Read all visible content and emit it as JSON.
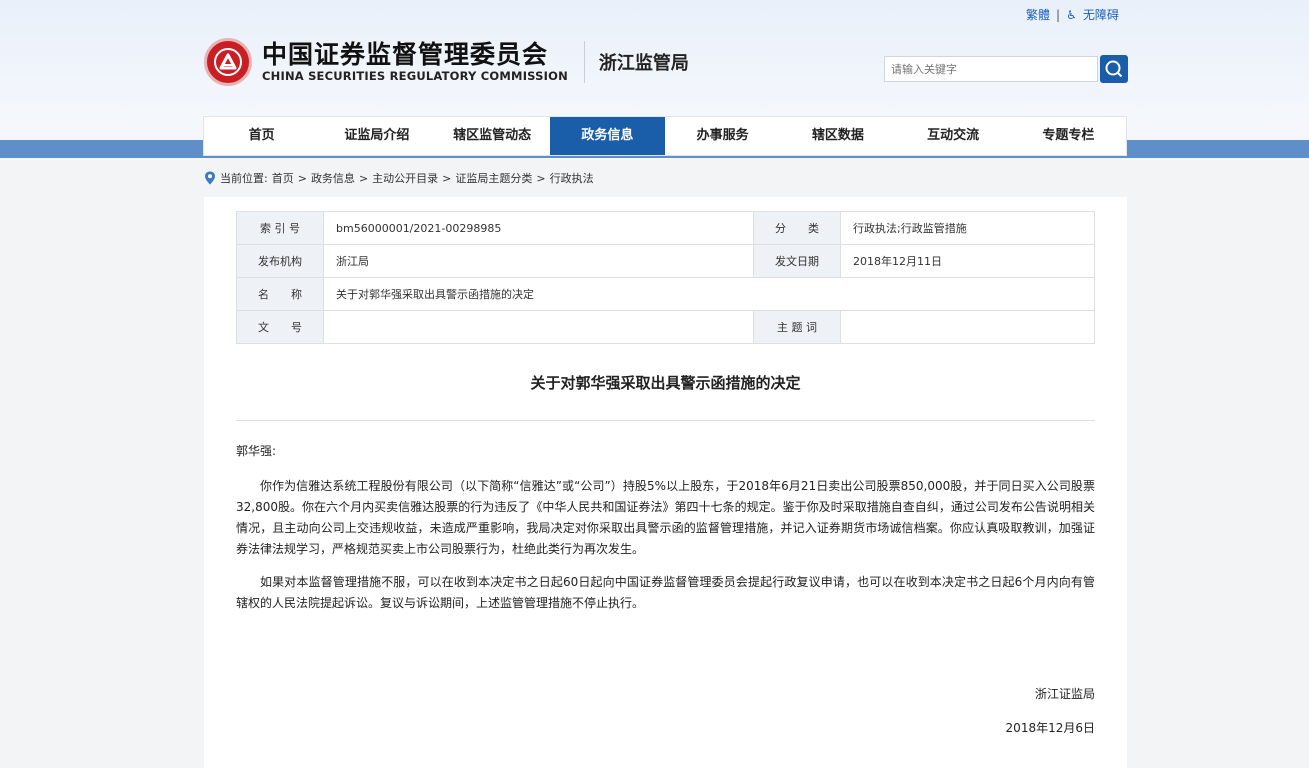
{
  "header": {
    "lang_toggle": "繁體",
    "accessibility": "无障碍",
    "logo_cn": "中国证券监督管理委员会",
    "logo_en": "CHINA SECURITIES REGULATORY COMMISSION",
    "bureau": "浙江监管局",
    "search_placeholder": "请输入关键字"
  },
  "nav": {
    "items": [
      "首页",
      "证监局介绍",
      "辖区监管动态",
      "政务信息",
      "办事服务",
      "辖区数据",
      "互动交流",
      "专题专栏"
    ],
    "active_index": 3
  },
  "breadcrumb": {
    "prefix": "当前位置:",
    "items": [
      "首页",
      "政务信息",
      "主动公开目录",
      "证监局主题分类",
      "行政执法"
    ],
    "separator": ">"
  },
  "meta": {
    "index_label": "索 引 号",
    "index_value": "bm56000001/2021-00298985",
    "category_label": "分　　类",
    "category_value": "行政执法;行政监管措施",
    "publisher_label": "发布机构",
    "publisher_value": "浙江局",
    "date_label": "发文日期",
    "date_value": "2018年12月11日",
    "name_label": "名　　称",
    "name_value": "关于对郭华强采取出具警示函措施的决定",
    "docno_label": "文　　号",
    "docno_value": "",
    "keyword_label": "主 题 词",
    "keyword_value": ""
  },
  "document": {
    "title": "关于对郭华强采取出具警示函措施的决定",
    "salutation": "郭华强:",
    "paragraph1": "你作为信雅达系统工程股份有限公司（以下简称“信雅达”或“公司”）持股5%以上股东，于2018年6月21日卖出公司股票850,000股，并于同日买入公司股票32,800股。你在六个月内买卖信雅达股票的行为违反了《中华人民共和国证券法》第四十七条的规定。鉴于你及时采取措施自查自纠，通过公司发布公告说明相关情况，且主动向公司上交违规收益，未造成严重影响，我局决定对你采取出具警示函的监督管理措施，并记入证券期货市场诚信档案。你应认真吸取教训，加强证券法律法规学习，严格规范买卖上市公司股票行为，杜绝此类行为再次发生。",
    "paragraph2": "如果对本监督管理措施不服，可以在收到本决定书之日起60日起向中国证券监督管理委员会提起行政复议申请，也可以在收到本决定书之日起6个月内向有管辖权的人民法院提起诉讼。复议与诉讼期间，上述监管管理措施不停止执行。",
    "signature": "浙江证监局",
    "sign_date": "2018年12月6日"
  },
  "colors": {
    "nav_active": "#1a5da8",
    "band": "#5f8fc8",
    "emblem": "#c81f25"
  }
}
